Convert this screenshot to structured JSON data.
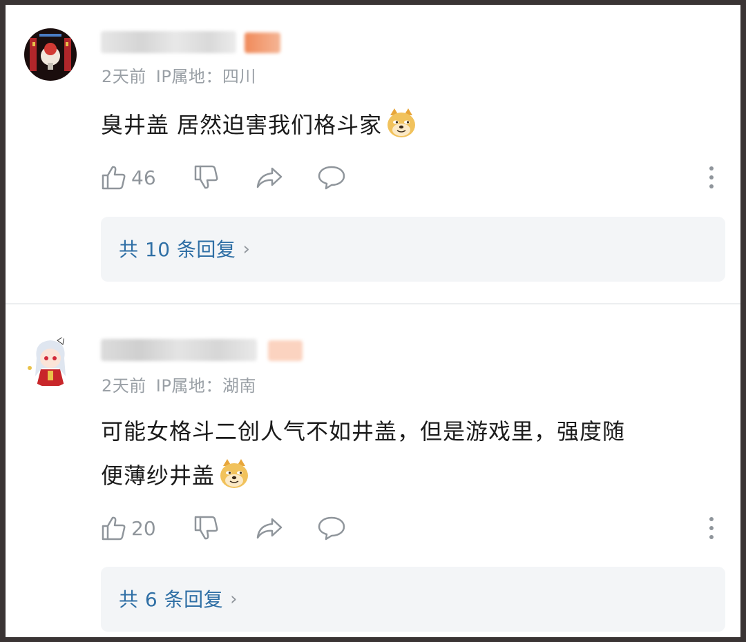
{
  "comments": [
    {
      "meta_time": "2天前",
      "meta_ip": "IP属地：四川",
      "text_lines": [
        "臭井盖 居然迫害我们格斗家"
      ],
      "emoji": "doge-emoji",
      "likes": "46",
      "replies_label": "共 10 条回复"
    },
    {
      "meta_time": "2天前",
      "meta_ip": "IP属地：湖南",
      "text_lines": [
        "可能女格斗二创人气不如井盖，但是游戏里，强度随",
        "便薄纱井盖"
      ],
      "emoji": "doge-emoji",
      "likes": "20",
      "replies_label": "共 6 条回复"
    }
  ],
  "icons": {
    "like": "thumbs-up-icon",
    "dislike": "thumbs-down-icon",
    "share": "share-arrow-icon",
    "comment": "comment-bubble-icon",
    "more": "more-vertical-icon",
    "chevron": "chevron-right-icon"
  },
  "colors": {
    "reply_link": "#2f6fa5",
    "meta": "#9aa0a6",
    "reply_bg": "#f3f5f7"
  }
}
